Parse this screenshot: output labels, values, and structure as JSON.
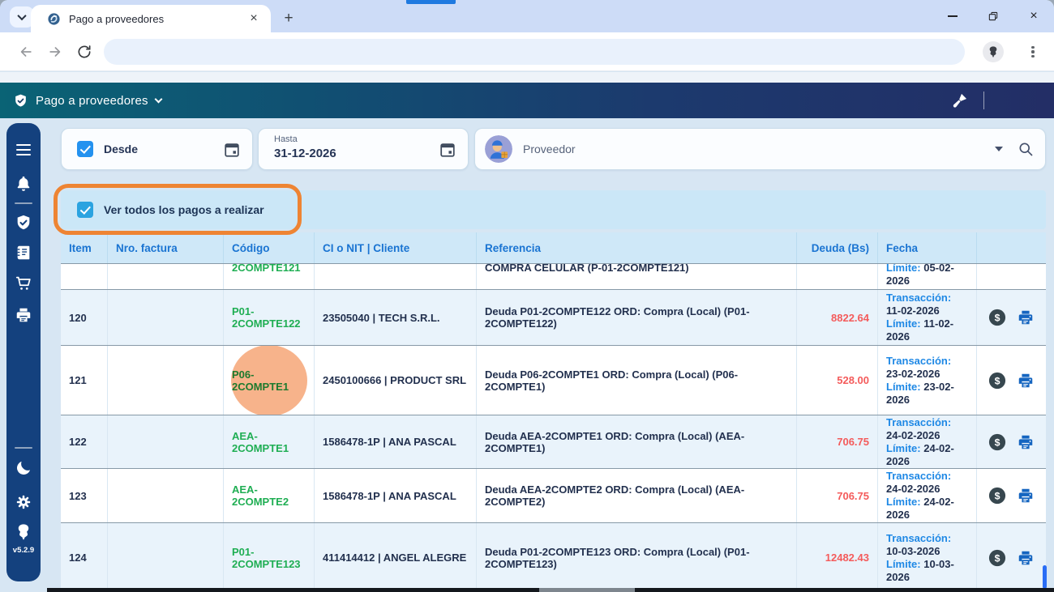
{
  "browser": {
    "tab_title": "Pago a proveedores"
  },
  "app_header": {
    "title": "Pago a proveedores"
  },
  "filters": {
    "desde_label": "Desde",
    "hasta_label": "Hasta",
    "hasta_value": "31-12-2026",
    "proveedor_placeholder": "Proveedor"
  },
  "toggle": {
    "label": "Ver todos los pagos a realizar"
  },
  "table": {
    "columns": [
      "Item",
      "Nro. factura",
      "Código",
      "CI o NIT | Cliente",
      "Referencia",
      "Deuda (Bs)",
      "Fecha"
    ],
    "fecha_labels": {
      "transaccion": "Transacción:",
      "limite": "Límite:"
    },
    "partial_row": {
      "codigo": "2COMPTE121",
      "referencia": "COMPRA CELULAR (P-01-2COMPTE121)",
      "limite": "05-02-2026"
    },
    "rows": [
      {
        "item": "120",
        "codigo": "P01-2COMPTE122",
        "cliente": "23505040 | TECH S.R.L.",
        "referencia": "Deuda P01-2COMPTE122 ORD: Compra (Local) (P01-2COMPTE122)",
        "deuda": "8822.64",
        "transaccion": "11-02-2026",
        "limite": "11-02-2026",
        "highlighted": false
      },
      {
        "item": "121",
        "codigo": "P06-2COMPTE1",
        "cliente": "2450100666 | PRODUCT SRL",
        "referencia": "Deuda P06-2COMPTE1 ORD: Compra (Local) (P06-2COMPTE1)",
        "deuda": "528.00",
        "transaccion": "23-02-2026",
        "limite": "23-02-2026",
        "highlighted": true
      },
      {
        "item": "122",
        "codigo": "AEA-2COMPTE1",
        "cliente": "1586478-1P | ANA PASCAL",
        "referencia": "Deuda AEA-2COMPTE1 ORD: Compra (Local) (AEA-2COMPTE1)",
        "deuda": "706.75",
        "transaccion": "24-02-2026",
        "limite": "24-02-2026",
        "highlighted": false
      },
      {
        "item": "123",
        "codigo": "AEA-2COMPTE2",
        "cliente": "1586478-1P | ANA PASCAL",
        "referencia": "Deuda AEA-2COMPTE2 ORD: Compra (Local) (AEA-2COMPTE2)",
        "deuda": "706.75",
        "transaccion": "24-02-2026",
        "limite": "24-02-2026",
        "highlighted": false
      },
      {
        "item": "124",
        "codigo": "P01-2COMPTE123",
        "cliente": "411414412 | ANGEL ALEGRE",
        "referencia": "Deuda P01-2COMPTE123 ORD: Compra (Local) (P01-2COMPTE123)",
        "deuda": "12482.43",
        "transaccion": "10-03-2026",
        "limite": "10-03-2026",
        "highlighted": false
      }
    ]
  },
  "sidebar": {
    "version": "v5.2.9",
    "items": [
      "menu",
      "notifications",
      "security",
      "journal",
      "purchases",
      "print",
      "dark-mode",
      "settings",
      "brand-logo"
    ]
  },
  "colors": {
    "annotation_orange": "#ee8433",
    "deuda_red": "#f45b5b",
    "codigo_green": "#1fae53",
    "link_blue": "#1e88e5",
    "header_gradient_start": "#0a6375",
    "header_gradient_end": "#232e66",
    "sidebar_navy": "#14417e"
  }
}
